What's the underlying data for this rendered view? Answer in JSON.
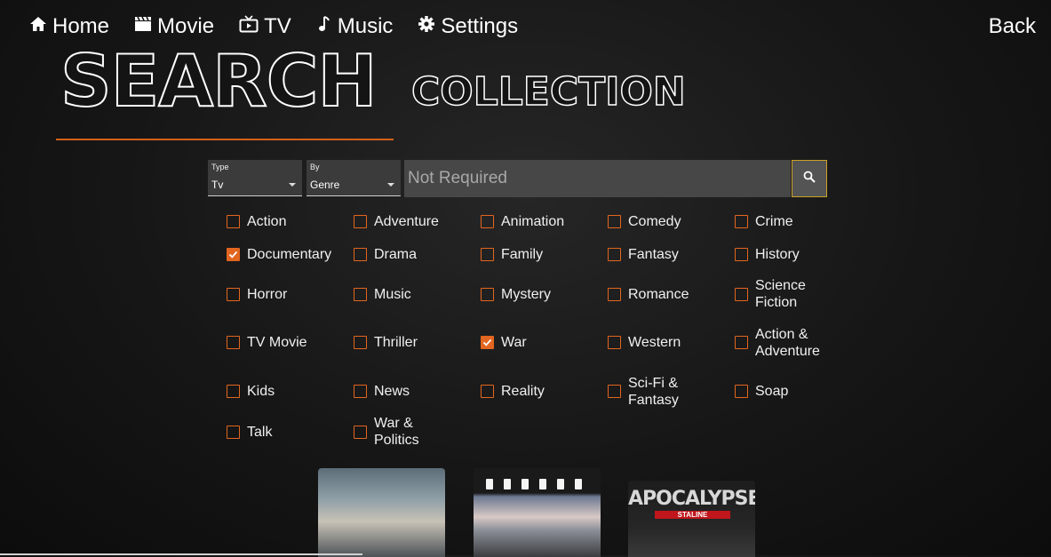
{
  "nav": {
    "items": [
      {
        "label": "Home",
        "icon": "home-icon"
      },
      {
        "label": "Movie",
        "icon": "clapperboard-icon"
      },
      {
        "label": "TV",
        "icon": "tv-icon"
      },
      {
        "label": "Music",
        "icon": "music-note-icon"
      },
      {
        "label": "Settings",
        "icon": "gear-icon"
      }
    ],
    "back_label": "Back"
  },
  "title": {
    "main": "SEARCH",
    "sub": "COLLECTION"
  },
  "filters": {
    "type": {
      "label": "Type",
      "value": "Tv"
    },
    "by": {
      "label": "By",
      "value": "Genre"
    },
    "search_placeholder": "Not Required"
  },
  "genres": [
    {
      "label": "Action",
      "checked": false
    },
    {
      "label": "Adventure",
      "checked": false
    },
    {
      "label": "Animation",
      "checked": false
    },
    {
      "label": "Comedy",
      "checked": false
    },
    {
      "label": "Crime",
      "checked": false
    },
    {
      "label": "Documentary",
      "checked": true
    },
    {
      "label": "Drama",
      "checked": false
    },
    {
      "label": "Family",
      "checked": false
    },
    {
      "label": "Fantasy",
      "checked": false
    },
    {
      "label": "History",
      "checked": false
    },
    {
      "label": "Horror",
      "checked": false
    },
    {
      "label": "Music",
      "checked": false
    },
    {
      "label": "Mystery",
      "checked": false
    },
    {
      "label": "Romance",
      "checked": false
    },
    {
      "label": "Science Fiction",
      "checked": false
    },
    {
      "label": "TV Movie",
      "checked": false
    },
    {
      "label": "Thriller",
      "checked": false
    },
    {
      "label": "War",
      "checked": true
    },
    {
      "label": "Western",
      "checked": false
    },
    {
      "label": "Action & Adventure",
      "checked": false
    },
    {
      "label": "Kids",
      "checked": false
    },
    {
      "label": "News",
      "checked": false
    },
    {
      "label": "Reality",
      "checked": false
    },
    {
      "label": "Sci-Fi & Fantasy",
      "checked": false
    },
    {
      "label": "Soap",
      "checked": false
    },
    {
      "label": "Talk",
      "checked": false
    },
    {
      "label": "War & Politics",
      "checked": false
    }
  ],
  "posters": {
    "apocalypse_title": "APOCALYPSE",
    "apocalypse_subtitle": "STALINE"
  },
  "colors": {
    "accent": "#e2661f",
    "search_border": "#c9a227"
  }
}
